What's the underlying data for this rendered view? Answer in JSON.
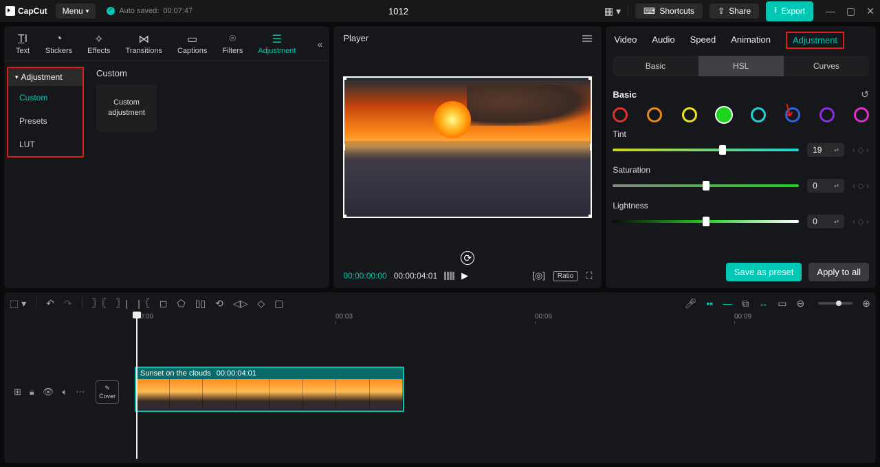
{
  "app": {
    "name": "CapCut",
    "menu_label": "Menu",
    "autosave_label": "Auto saved:",
    "autosave_time": "00:07:47",
    "project_title": "1012"
  },
  "topbar": {
    "shortcuts": "Shortcuts",
    "share": "Share",
    "export": "Export"
  },
  "tool_tabs": [
    "Text",
    "Stickers",
    "Effects",
    "Transitions",
    "Captions",
    "Filters",
    "Adjustment"
  ],
  "left_sidebar": {
    "header": "Adjustment",
    "items": [
      "Custom",
      "Presets",
      "LUT"
    ]
  },
  "left_content": {
    "title": "Custom",
    "card": "Custom\nadjustment"
  },
  "player": {
    "title": "Player",
    "time_current": "00:00:00:00",
    "time_duration": "00:00:04:01",
    "ratio_label": "Ratio"
  },
  "inspector": {
    "tabs": [
      "Video",
      "Audio",
      "Speed",
      "Animation",
      "Adjustment"
    ],
    "subtabs": [
      "Basic",
      "HSL",
      "Curves"
    ],
    "section": "Basic",
    "sliders": {
      "tint": {
        "label": "Tint",
        "value": "19",
        "pos": 59
      },
      "saturation": {
        "label": "Saturation",
        "value": "0",
        "pos": 50
      },
      "lightness": {
        "label": "Lightness",
        "value": "0",
        "pos": 50
      }
    },
    "actions": {
      "save_preset": "Save as preset",
      "apply_all": "Apply to all"
    }
  },
  "timeline": {
    "ticks": [
      "00:00",
      "00:03",
      "00:06",
      "00:09"
    ],
    "clip": {
      "name": "Sunset on the clouds",
      "duration": "00:00:04:01"
    },
    "cover_label": "Cover"
  }
}
